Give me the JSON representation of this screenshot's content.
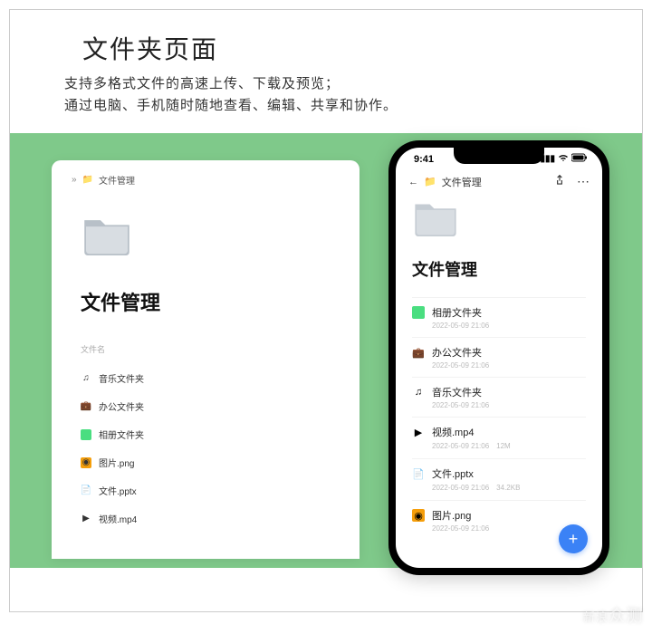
{
  "header": {
    "title": "文件夹页面",
    "subtitle_line1": "支持多格式文件的高速上传、下载及预览；",
    "subtitle_line2": "通过电脑、手机随时随地查看、编辑、共享和协作。"
  },
  "desktop": {
    "breadcrumb_label": "文件管理",
    "heading": "文件管理",
    "column_header": "文件名",
    "items": [
      {
        "icon": "music",
        "name": "音乐文件夹"
      },
      {
        "icon": "office",
        "name": "办公文件夹"
      },
      {
        "icon": "album",
        "name": "相册文件夹"
      },
      {
        "icon": "image",
        "name": "图片.png"
      },
      {
        "icon": "doc",
        "name": "文件.pptx"
      },
      {
        "icon": "video",
        "name": "视频.mp4"
      }
    ]
  },
  "phone": {
    "status_time": "9:41",
    "breadcrumb_label": "文件管理",
    "heading": "文件管理",
    "items": [
      {
        "icon": "album",
        "name": "相册文件夹",
        "date": "2022-05-09 21:06",
        "size": ""
      },
      {
        "icon": "office",
        "name": "办公文件夹",
        "date": "2022-05-09 21:06",
        "size": ""
      },
      {
        "icon": "music",
        "name": "音乐文件夹",
        "date": "2022-05-09 21:06",
        "size": ""
      },
      {
        "icon": "video",
        "name": "视频.mp4",
        "date": "2022-05-09 21:06",
        "size": "12M"
      },
      {
        "icon": "doc",
        "name": "文件.pptx",
        "date": "2022-05-09 21:06",
        "size": "34.2KB"
      },
      {
        "icon": "image",
        "name": "图片.png",
        "date": "2022-05-09 21:06",
        "size": ""
      }
    ],
    "fab_label": "+"
  },
  "watermark": {
    "brand": "新浪",
    "sub": "众测"
  }
}
